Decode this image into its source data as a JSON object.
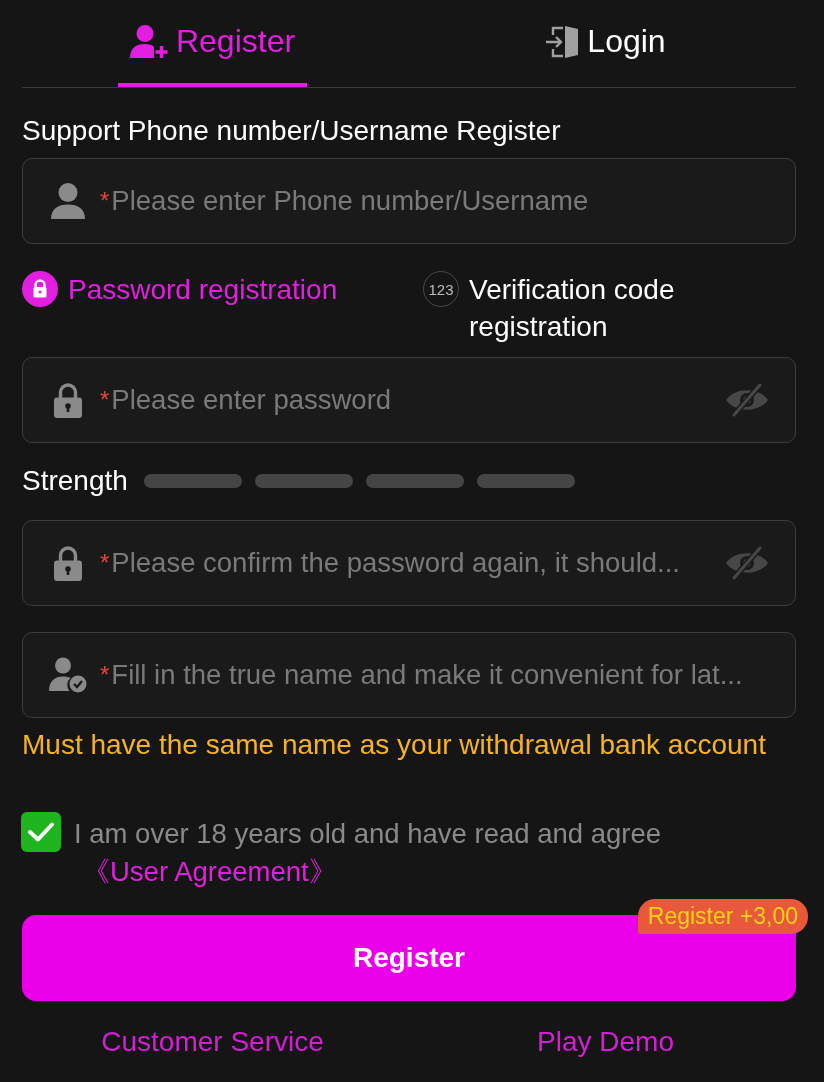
{
  "tabs": [
    {
      "label": "Register",
      "selected": true
    },
    {
      "label": "Login",
      "selected": false
    }
  ],
  "account_label": "Support Phone number/Username Register",
  "account_field": {
    "kind": "person",
    "marker": "*",
    "placeholder": "Please enter Phone number/Username"
  },
  "registration_modes": [
    {
      "kind": "password",
      "label": "Password registration",
      "selected": true
    },
    {
      "kind": "code",
      "icon_text": "123",
      "label": "Verification code registration",
      "selected": false
    }
  ],
  "password_field": {
    "kind": "lock",
    "marker": "*",
    "placeholder": "Please enter password",
    "masked": true
  },
  "strength": {
    "label": "Strength",
    "segments": [
      {
        "on": false
      },
      {
        "on": false
      },
      {
        "on": false
      },
      {
        "on": false
      }
    ]
  },
  "confirm_field": {
    "kind": "lock",
    "marker": "*",
    "placeholder": "Please confirm the password again, it should...",
    "masked": true
  },
  "name_field": {
    "kind": "person-check",
    "marker": "*",
    "placeholder": "Fill in the true name and make it convenient for lat..."
  },
  "name_hint": "Must have the same name as your withdrawal bank account",
  "agreement": {
    "checked": true,
    "text": "I am over 18 years old and have read and agree",
    "link": "《User Agreement》"
  },
  "register_button": {
    "label": "Register",
    "bonus_badge": "Register +3,00"
  },
  "footer_links": [
    "Customer Service",
    "Play Demo"
  ]
}
